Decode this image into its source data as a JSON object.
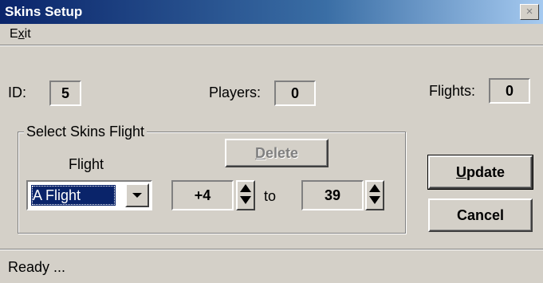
{
  "window": {
    "title": "Skins Setup",
    "close_symbol": "×"
  },
  "menu": {
    "exit_prefix": "E",
    "exit_mnemonic": "x",
    "exit_suffix": "it"
  },
  "info": {
    "id_label": "ID:",
    "id_value": "5",
    "players_label": "Players:",
    "players_value": "0",
    "flights_label": "Flights:",
    "flights_value": "0"
  },
  "group": {
    "title": "Select Skins Flight",
    "flight_label": "Flight",
    "flight_selected": "A Flight",
    "from_value": "+4",
    "to_label": "to",
    "to_value": "39"
  },
  "buttons": {
    "delete_mnemonic": "D",
    "delete_rest": "elete",
    "update_mnemonic": "U",
    "update_rest": "pdate",
    "cancel_label": "Cancel"
  },
  "status": {
    "text": "Ready ..."
  }
}
